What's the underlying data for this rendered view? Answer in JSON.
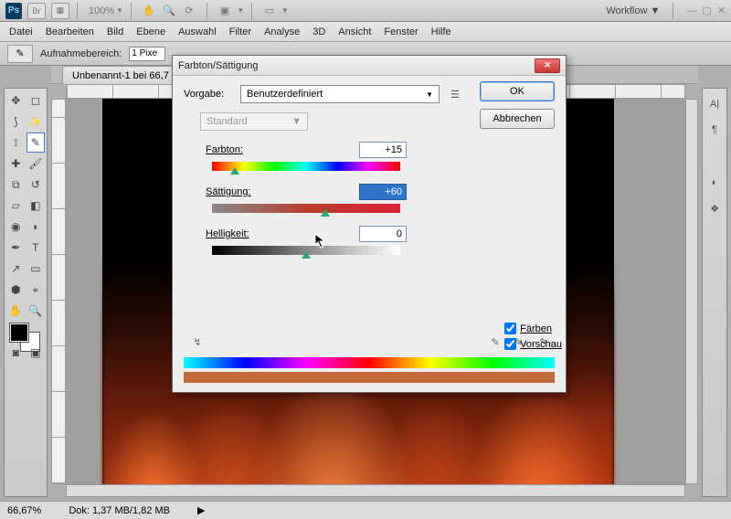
{
  "app": {
    "id": "Ps",
    "br": "Br",
    "zoom": "100%",
    "workspace_label": "Workflow"
  },
  "menu": [
    "Datei",
    "Bearbeiten",
    "Bild",
    "Ebene",
    "Auswahl",
    "Filter",
    "Analyse",
    "3D",
    "Ansicht",
    "Fenster",
    "Hilfe"
  ],
  "options": {
    "label": "Aufnahmebereich:",
    "value": "1 Pixe"
  },
  "doc": {
    "tab": "Unbenannt-1 bei 66,7"
  },
  "status": {
    "zoom": "66,67%",
    "doc": "Dok: 1,37 MB/1,82 MB"
  },
  "dialog": {
    "title": "Farbton/Sättigung",
    "preset_label": "Vorgabe:",
    "preset_value": "Benutzerdefiniert",
    "ok": "OK",
    "cancel": "Abbrechen",
    "channel": "Standard",
    "hue_label": "Farbton:",
    "hue_value": "+15",
    "sat_label": "Sättigung:",
    "sat_value": "+60",
    "light_label": "Helligkeit:",
    "light_value": "0",
    "colorize": "Färben",
    "preview": "Vorschau"
  }
}
